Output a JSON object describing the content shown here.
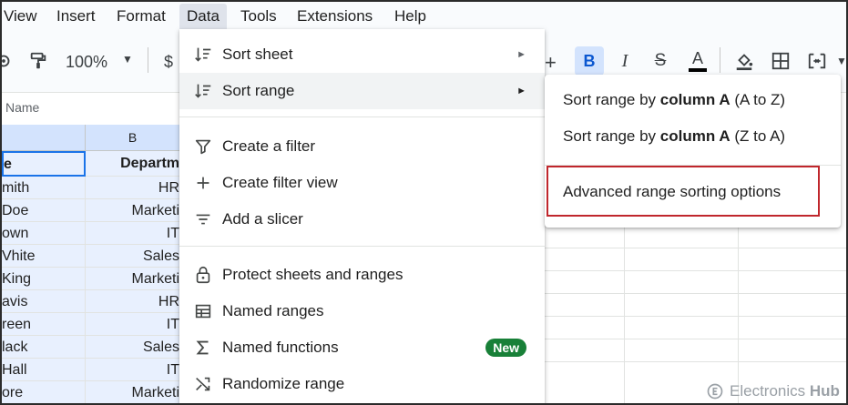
{
  "menubar": {
    "items": [
      {
        "label": "View"
      },
      {
        "label": "Insert"
      },
      {
        "label": "Format"
      },
      {
        "label": "Data"
      },
      {
        "label": "Tools"
      },
      {
        "label": "Extensions"
      },
      {
        "label": "Help"
      }
    ]
  },
  "toolbar": {
    "zoom": "100%",
    "currency": "$",
    "plus": "+",
    "bold": "B",
    "italic": "I",
    "strike": "S",
    "text_color": "A"
  },
  "namebox": {
    "value": "Name"
  },
  "grid": {
    "column_b_header": "B",
    "header_row": {
      "a": "e",
      "b": "Departm"
    },
    "rows": [
      {
        "a": "mith",
        "b": "HR"
      },
      {
        "a": "Doe",
        "b": "Marketi"
      },
      {
        "a": "own",
        "b": "IT"
      },
      {
        "a": "Vhite",
        "b": "Sales"
      },
      {
        "a": "King",
        "b": "Marketi"
      },
      {
        "a": "avis",
        "b": "HR"
      },
      {
        "a": "reen",
        "b": "IT"
      },
      {
        "a": "lack",
        "b": "Sales"
      },
      {
        "a": "Hall",
        "b": "IT"
      },
      {
        "a": "ore",
        "b": "Marketi"
      }
    ]
  },
  "data_menu": {
    "items": [
      {
        "label": "Sort sheet",
        "icon": "sort-icon"
      },
      {
        "label": "Sort range",
        "icon": "sort-icon"
      },
      {
        "label": "Create a filter",
        "icon": "filter-icon"
      },
      {
        "label": "Create filter view",
        "icon": "plus-icon"
      },
      {
        "label": "Add a slicer",
        "icon": "slicer-icon"
      },
      {
        "label": "Protect sheets and ranges",
        "icon": "lock-icon"
      },
      {
        "label": "Named ranges",
        "icon": "table-icon"
      },
      {
        "label": "Named functions",
        "icon": "sigma-icon",
        "badge": "New"
      },
      {
        "label": "Randomize range",
        "icon": "shuffle-icon"
      }
    ]
  },
  "sort_submenu": {
    "items": [
      {
        "prefix": "Sort range by ",
        "bold": "column A",
        "suffix": " (A to Z)"
      },
      {
        "prefix": "Sort range by ",
        "bold": "column A",
        "suffix": " (Z to A)"
      },
      {
        "label": "Advanced range sorting options"
      }
    ]
  },
  "watermark": {
    "brand": "Electronics",
    "brand_bold": "Hub"
  },
  "colors": {
    "accent": "#1a73e8",
    "highlight": "#c0262c",
    "badge": "#188038"
  }
}
